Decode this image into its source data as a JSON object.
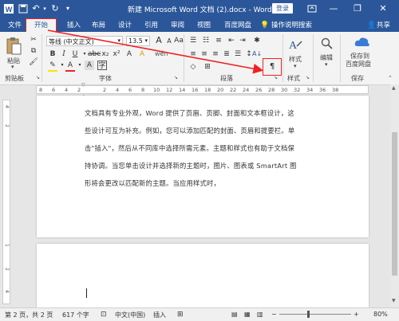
{
  "window": {
    "title": "新建 Microsoft Word 文档 (2).docx - Word",
    "login_label": "登录"
  },
  "tabs": [
    {
      "label": "文件"
    },
    {
      "label": "开始"
    },
    {
      "label": "插入"
    },
    {
      "label": "布局"
    },
    {
      "label": "设计"
    },
    {
      "label": "引用"
    },
    {
      "label": "审阅"
    },
    {
      "label": "视图"
    },
    {
      "label": "百度网盘"
    },
    {
      "label": "操作说明搜索"
    },
    {
      "label": "共享"
    }
  ],
  "ribbon": {
    "paste_label": "粘贴",
    "clipboard_label": "剪贴板",
    "font_name": "等线 (中文正文)",
    "font_size": "13.5",
    "font_group_label": "字体",
    "paragraph_label": "段落",
    "styles_button_label": "样式",
    "styles_group_label": "样式",
    "edit_button_label": "编辑",
    "save_baidu_label_1": "保存到",
    "save_baidu_label_2": "百度网盘",
    "save_group_label": "保存",
    "wen_glyph": "wén",
    "font_a": "A"
  },
  "ruler": {
    "numbers": [
      "8",
      "6",
      "4",
      "2",
      "2",
      "4",
      "6",
      "8",
      "10",
      "12",
      "14",
      "16",
      "18",
      "20",
      "22",
      "24",
      "26",
      "28",
      "30",
      "32",
      "34",
      "36",
      "38"
    ]
  },
  "vruler": {
    "numbers": [
      "4",
      "2",
      "1",
      "2",
      "4"
    ]
  },
  "document": {
    "lines": [
      "文档具有专业外观，Word 提供了页眉、页脚、封面和文本框设计，这",
      "些设计可互为补充。例如，您可以添加匹配的封面、页眉和提要栏。单",
      "击\"插入\"，然后从不同库中选择所需元素。主题和样式也有助于文档保",
      "持协调。当您单击设计并选择新的主题时，图片、图表或 SmartArt 图",
      "形将会更改以匹配新的主题。当应用样式时，"
    ]
  },
  "status": {
    "page": "第 2 页，共 2 页",
    "words": "617 个字",
    "language": "中文(中国)",
    "mode": "插入",
    "zoom": "80%"
  },
  "colors": {
    "title_bar": "#2b579a",
    "highlight": "#e22222"
  }
}
